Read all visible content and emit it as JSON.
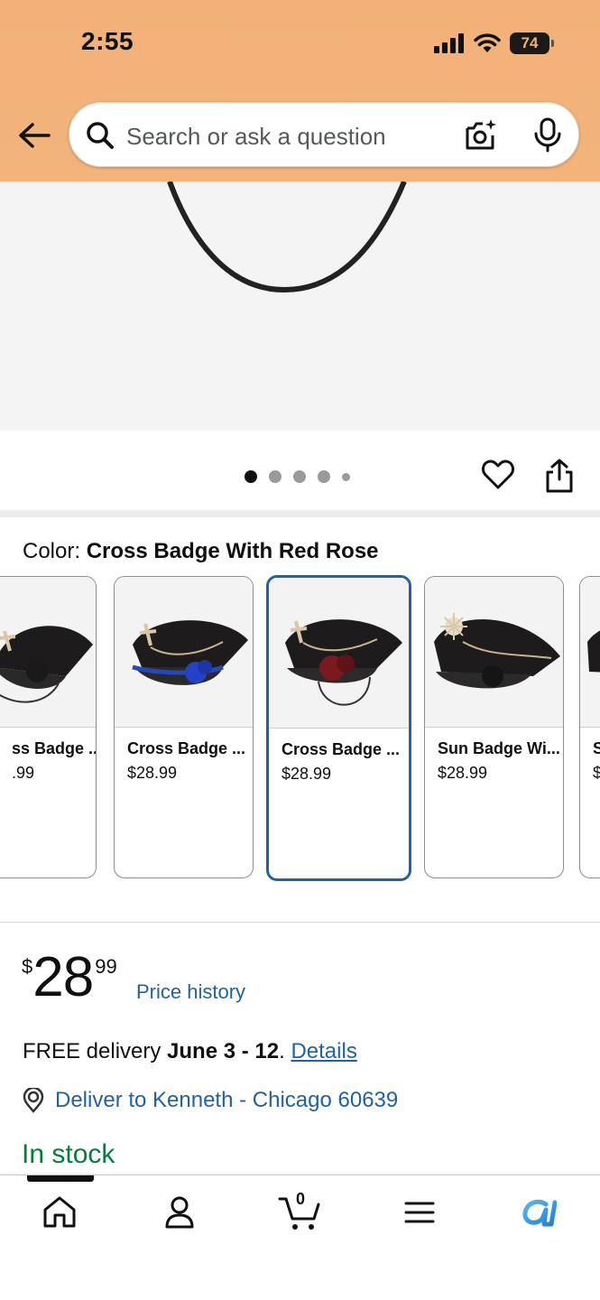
{
  "status_bar": {
    "time": "2:55",
    "battery": "74"
  },
  "search": {
    "placeholder": "Search or ask a question"
  },
  "carousel": {
    "dot_count": 5,
    "active_index": 0
  },
  "color": {
    "label": "Color: ",
    "selected": "Cross Badge With Red Rose",
    "options": [
      {
        "name": "ss Badge ...",
        "price": ".99"
      },
      {
        "name": "Cross Badge ...",
        "price": "$28.99"
      },
      {
        "name": "Cross Badge ...",
        "price": "$28.99"
      },
      {
        "name": "Sun Badge Wi...",
        "price": "$28.99"
      },
      {
        "name": "S",
        "price": "$"
      }
    ]
  },
  "price": {
    "symbol": "$",
    "whole": "28",
    "fraction": "99",
    "history_link": "Price history"
  },
  "delivery": {
    "prefix": "FREE delivery ",
    "dates": "June 3 - 12",
    "suffix": ". ",
    "details_link": "Details"
  },
  "location": {
    "text": "Deliver to Kenneth - Chicago 60639"
  },
  "stock": {
    "text": "In stock"
  },
  "bottom_nav": {
    "cart_count": "0",
    "items": [
      "home-icon",
      "account-icon",
      "cart-icon",
      "menu-icon",
      "rufus-icon"
    ]
  },
  "colors": {
    "header": "#f3b27a",
    "link": "#2162a1",
    "stock": "#067d3d",
    "selected_border": "#2162a1"
  }
}
